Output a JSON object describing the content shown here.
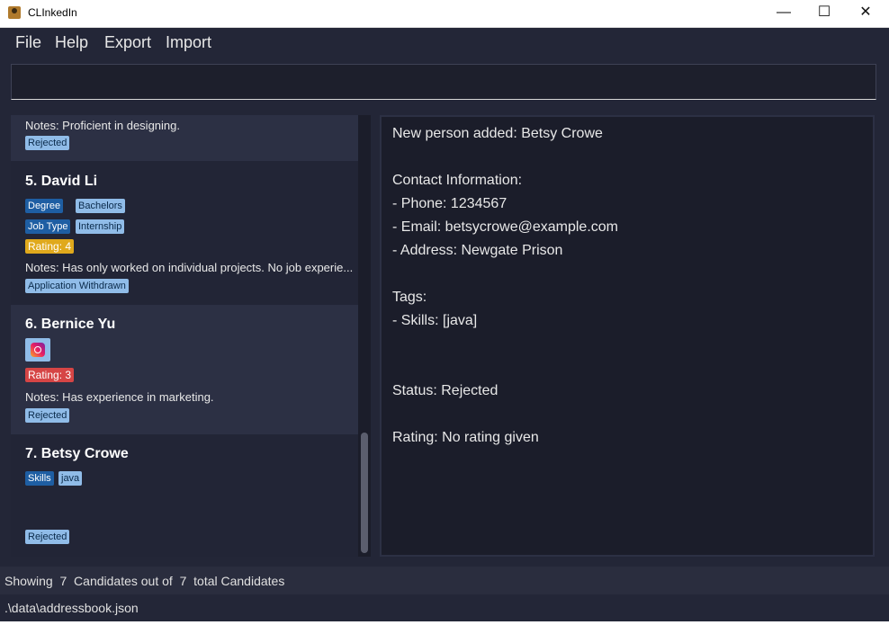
{
  "window": {
    "title": "CLInkedIn",
    "minimize": "—",
    "maximize": "☐",
    "close": "✕"
  },
  "menu": {
    "items": [
      "File",
      "Help",
      "Export",
      "Import"
    ]
  },
  "command_box": {
    "value": ""
  },
  "candidates": [
    {
      "notes": "Notes: Proficient in designing.",
      "status": "Rejected"
    },
    {
      "index": "5.",
      "name": "David Li",
      "tag_rows": [
        [
          "Degree",
          "Bachelors"
        ],
        [
          "Job Type",
          "Internship"
        ]
      ],
      "rating": "Rating: 4",
      "notes": "Notes: Has only worked on individual projects. No job experie...",
      "status": "Application Withdrawn"
    },
    {
      "index": "6.",
      "name": "Bernice Yu",
      "icon": "instagram-icon",
      "rating": "Rating: 3",
      "notes": "Notes: Has experience in marketing.",
      "status": "Rejected"
    },
    {
      "index": "7.",
      "name": "Betsy Crowe",
      "tags": [
        "Skills",
        "java"
      ],
      "status": "Rejected"
    }
  ],
  "detail": {
    "lines": [
      "New person added: Betsy Crowe",
      "Contact Information:",
      "- Phone: 1234567",
      "- Email: betsycrowe@example.com",
      "- Address: Newgate Prison",
      "Tags:",
      "- Skills: [java]",
      "Status: Rejected",
      "Rating: No rating given"
    ]
  },
  "status_bar": {
    "text": "Showing  7  Candidates out of  7  total Candidates"
  },
  "footer": {
    "path": ".\\data\\addressbook.json"
  },
  "colors": {
    "background": "#232637",
    "panel": "#1b1d2a",
    "tag_dark": "#1e5ea3",
    "tag_light": "#90bce8",
    "rating_yellow": "#e0a91c",
    "rating_red": "#d64545"
  }
}
